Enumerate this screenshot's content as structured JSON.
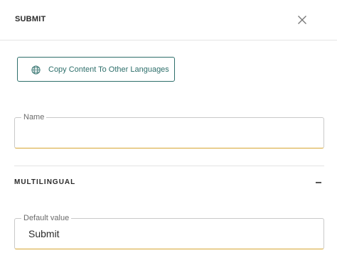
{
  "header": {
    "title": "SUBMIT",
    "close_icon": "close-icon"
  },
  "copy_button": {
    "label": "Copy Content To Other Languages",
    "icon": "globe-icon"
  },
  "name_field": {
    "label": "Name",
    "value": ""
  },
  "multilingual": {
    "title": "MULTILINGUAL",
    "toggle_icon": "minus-icon",
    "expanded": true
  },
  "default_value_field": {
    "label": "Default value",
    "value": "Submit"
  },
  "colors": {
    "accent_teal": "#2e6f6b",
    "field_underline": "#d6a531"
  }
}
